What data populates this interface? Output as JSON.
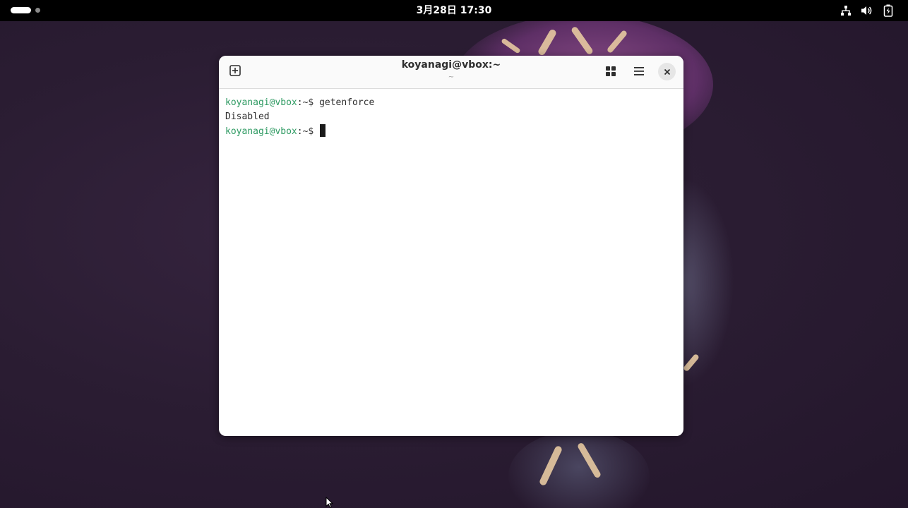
{
  "topbar": {
    "clock": "3月28日 17:30",
    "tray_icons": [
      "network-icon",
      "volume-icon",
      "battery-icon"
    ]
  },
  "terminal": {
    "title": "koyanagi@vbox:~",
    "subtitle": "~",
    "buttons": [
      "new-tab-icon",
      "tab-overview-icon",
      "menu-icon",
      "close-icon"
    ],
    "lines": [
      {
        "user": "koyanagi@vbox",
        "path": ":~$ ",
        "command": "getenforce"
      },
      {
        "output": "Disabled"
      },
      {
        "user": "koyanagi@vbox",
        "path": ":~$ ",
        "command": ""
      }
    ]
  },
  "colors": {
    "prompt_user": "#2e9a62",
    "topbar_bg": "#000000",
    "desktop_bg": "#2b1d33"
  }
}
